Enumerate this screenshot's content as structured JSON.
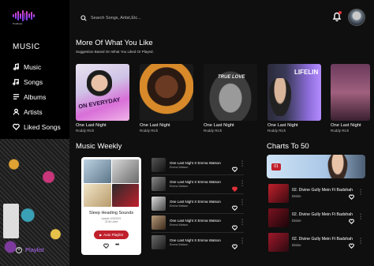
{
  "app": {
    "logo_text": "ProMusic"
  },
  "sidebar": {
    "title": "MUSIC",
    "items": [
      {
        "label": "Music",
        "icon": "music-note-icon"
      },
      {
        "label": "Songs",
        "icon": "music-notes-icon"
      },
      {
        "label": "Albums",
        "icon": "album-list-icon"
      },
      {
        "label": "Artists",
        "icon": "user-icon"
      },
      {
        "label": "Liked Songs",
        "icon": "heart-icon"
      }
    ],
    "playlist_label": "Playlist"
  },
  "header": {
    "search_placeholder": "Search Songs, Artist,Etc...",
    "bell_icon": "bell-icon",
    "avatar": "user-avatar"
  },
  "more_like": {
    "title": "More Of What You Like",
    "subtitle": "Suggestion Based On What You Liked Or Played.",
    "albums": [
      {
        "title": "One Last Night",
        "artist": "Roddy Rich",
        "cover_text": "ON EVERYDAY"
      },
      {
        "title": "One Last Night",
        "artist": "Roddy Rich",
        "cover_text": ""
      },
      {
        "title": "One Last Night",
        "artist": "Roddy Rich",
        "cover_text": "TRUE LOVE"
      },
      {
        "title": "One Last Night",
        "artist": "Roddy Rich",
        "cover_text": "LIFELIN"
      },
      {
        "title": "One Last Night",
        "artist": "Roddy Rich",
        "cover_text": ""
      }
    ]
  },
  "weekly": {
    "title": "Music Weekly",
    "card": {
      "title": "Sleep Heading Sounds",
      "meta_line1": "Update 10/5/2021",
      "meta_line2": "32.5k Liked",
      "button_label": "Auto Playlist"
    },
    "tracks": [
      {
        "title": "One Last Night X Emma Watson",
        "artist": "Emma Watson",
        "liked": false
      },
      {
        "title": "One Last Night X Emma Watson",
        "artist": "Emma Watson",
        "liked": true
      },
      {
        "title": "One Last Night X Emma Watson",
        "artist": "Emma Watson",
        "liked": false
      },
      {
        "title": "One Last Night X Emma Watson",
        "artist": "Emma Watson",
        "liked": false
      },
      {
        "title": "One Last Night X Emma Watson",
        "artist": "Emma Watson",
        "liked": false
      }
    ]
  },
  "charts": {
    "title": "Charts To 50",
    "banner_rank": "01",
    "rows": [
      {
        "title": "02. Divine Gully Mein Ft Badshah",
        "artist": "Divine"
      },
      {
        "title": "02. Divine Gully Mein Ft Badshah",
        "artist": "Divine"
      },
      {
        "title": "02. Divine Gully Mein Ft Badshah",
        "artist": "Divine"
      }
    ]
  },
  "colors": {
    "accent": "#c0202c",
    "background": "#0f0f0f",
    "sidebar": "#000000"
  }
}
